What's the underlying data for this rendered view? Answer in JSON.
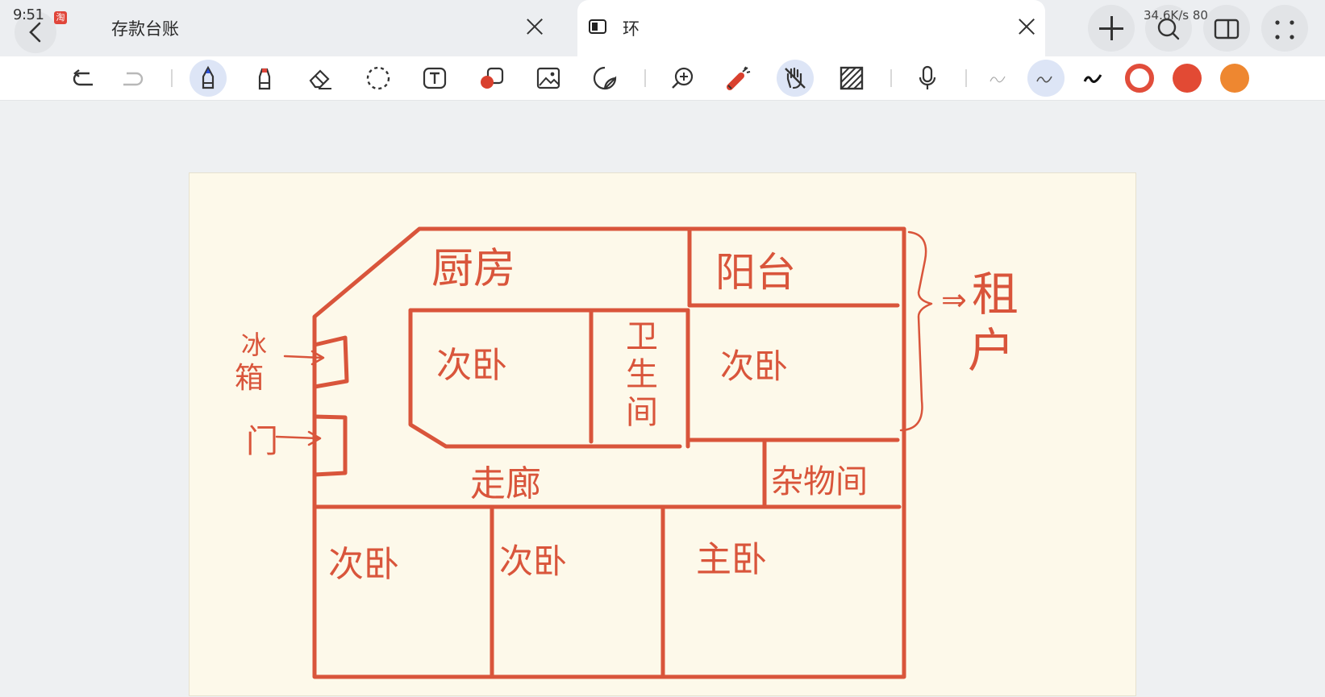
{
  "status_bar": {
    "time": "9:51",
    "notification_badge": "淘",
    "right": "34.6K/s 80"
  },
  "tabs": [
    {
      "title": "存款台账",
      "active": false
    },
    {
      "title": "环",
      "active": true
    }
  ],
  "toolbar": {
    "tools": [
      "undo-icon",
      "redo-icon",
      "pen-icon",
      "marker-icon",
      "eraser-icon",
      "lasso-icon",
      "text-box-icon",
      "shape-icon",
      "image-icon",
      "sticker-icon",
      "zoom-icon",
      "laser-pointer-icon",
      "hand-icon",
      "ruler-icon",
      "microphone-icon",
      "stroke-thin-icon",
      "stroke-medium-icon",
      "stroke-thick-icon"
    ],
    "active_tools": [
      "pen-icon",
      "hand-icon",
      "stroke-medium-icon"
    ],
    "colors": [
      "#e14d3b",
      "#e24a34",
      "#ee8730"
    ],
    "selected_color": "#e14d3b"
  },
  "drawing": {
    "ink_color": "#d9553b",
    "labels": {
      "kitchen": "厨房",
      "balcony": "阳台",
      "bedroom_center": "次卧",
      "bathroom_1": "卫",
      "bathroom_2": "生",
      "bathroom_3": "间",
      "bedroom_right": "次卧",
      "fridge_1": "冰",
      "fridge_2": "箱",
      "door": "门",
      "corridor": "走廊",
      "storage": "杂物间",
      "bedroom_bottom_1": "次卧",
      "bedroom_bottom_2": "次卧",
      "master_bedroom": "主卧",
      "rent_arrow": "⇒",
      "rent_1": "租",
      "rent_2": "户"
    }
  }
}
